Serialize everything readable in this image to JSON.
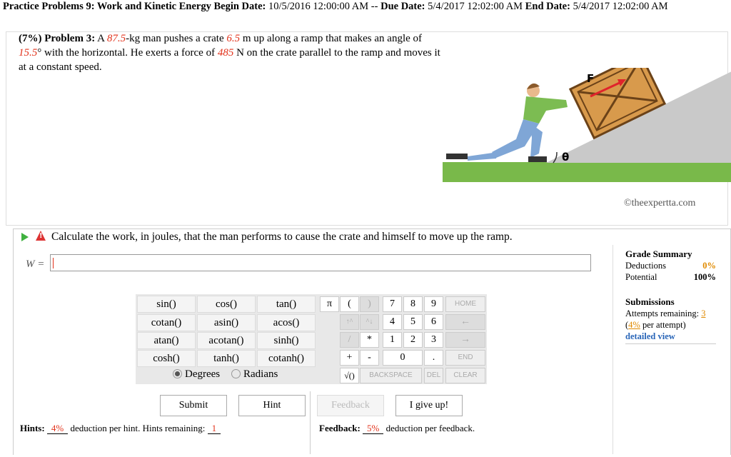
{
  "header": {
    "title": "Practice Problems 9: Work and Kinetic Energy",
    "begin_label": "Begin Date:",
    "begin_date": "10/5/2016 12:00:00 AM",
    "sep": "--",
    "due_label": "Due Date:",
    "due_date": "5/4/2017 12:02:00 AM",
    "end_label": "End Date:",
    "end_date": "5/4/2017 12:02:00 AM"
  },
  "problem": {
    "prefix": "(7%) Problem 3:",
    "t1": "A",
    "mass": "87.5",
    "t2": "-kg man pushes a crate",
    "dist": "6.5",
    "t3": "m up along a ramp that makes an angle of",
    "angle": "15.5",
    "t4": "° with the horizontal. He exerts a force of",
    "force": "485",
    "t5": "N on the crate parallel to the ramp and moves it at a constant speed."
  },
  "figure": {
    "force_label": "F",
    "angle_label": "θ",
    "copyright": "©theexpertta.com"
  },
  "question": {
    "text": "Calculate the work, in joules, that the man performs to cause the crate and himself to move up the ramp.",
    "var_label": "W =",
    "input_value": ""
  },
  "calculator": {
    "functions": [
      [
        "sin()",
        "cos()",
        "tan()"
      ],
      [
        "cotan()",
        "asin()",
        "acos()"
      ],
      [
        "atan()",
        "acotan()",
        "sinh()"
      ],
      [
        "cosh()",
        "tanh()",
        "cotanh()"
      ]
    ],
    "degrees": "Degrees",
    "radians": "Radians",
    "pi": "π",
    "lparen": "(",
    "rparen": ")",
    "k7": "7",
    "k8": "8",
    "k9": "9",
    "k4": "4",
    "k5": "5",
    "k6": "6",
    "k1": "1",
    "k2": "2",
    "k3": "3",
    "k0": "0",
    "home": "HOME",
    "uparrow": "↑^",
    "downarrow": "^↓",
    "left": "←",
    "divide": "/",
    "times": "*",
    "right": "→",
    "plus": "+",
    "minus": "-",
    "dot": ".",
    "end": "END",
    "sqrt": "√()",
    "backspace": "BACKSPACE",
    "del": "DEL",
    "clear": "CLEAR"
  },
  "actions": {
    "submit": "Submit",
    "hint": "Hint",
    "feedback": "Feedback",
    "give_up": "I give up!"
  },
  "hints": {
    "label": "Hints:",
    "deduction": "4%",
    "text": "deduction per hint. Hints remaining:",
    "remaining": "1"
  },
  "feedback": {
    "label": "Feedback:",
    "deduction": "5%",
    "text": "deduction per feedback."
  },
  "grade_summary": {
    "title": "Grade Summary",
    "deductions_label": "Deductions",
    "deductions_value": "0%",
    "potential_label": "Potential",
    "potential_value": "100%"
  },
  "submissions": {
    "title": "Submissions",
    "attempts_label": "Attempts remaining:",
    "attempts_value": "3",
    "per_attempt_value": "4%",
    "per_attempt_text": "per attempt)",
    "detailed_view": "detailed view"
  },
  "colors": {
    "accent_red": "#e2321b",
    "accent_orange": "#e08a00",
    "link_blue": "#2a66b8"
  }
}
